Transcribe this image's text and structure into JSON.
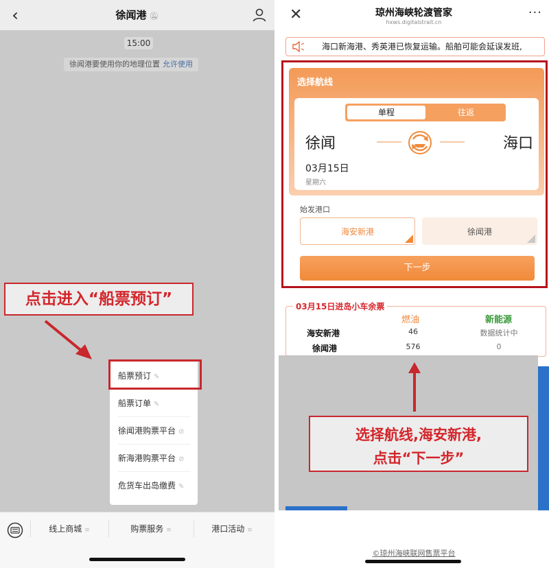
{
  "left": {
    "title": "徐闻港",
    "time": "15:00",
    "location_notice": "徐闻港要使用你的地理位置",
    "location_allow": "允许使用",
    "annotation": "点击进入“船票预订”",
    "menu": [
      "船票预订",
      "船票订单",
      "徐闻港购票平台",
      "新海港购票平台",
      "危货车出岛缴费"
    ],
    "tabs": [
      "线上商城",
      "购票服务",
      "港口活动"
    ],
    "colors": {
      "annotation_red": "#c8272c"
    }
  },
  "right": {
    "title": "琼州海峡轮渡管家",
    "url": "hxws.digitalstrait.cn",
    "notice": "海口新海港、秀英港已恢复运输。船舶可能会延误发班,",
    "section_label": "选择航线",
    "trip_one_way": "单程",
    "trip_round": "往返",
    "from_city": "徐闻",
    "to_city": "海口",
    "date": "03月15日",
    "weekday": "星期六",
    "port_label": "始发港口",
    "ports": [
      "海安新港",
      "徐闻港"
    ],
    "next_button": "下一步",
    "stats": {
      "title": "03月15日进岛小车余票",
      "headers": [
        "燃油",
        "新能源"
      ],
      "rows": [
        {
          "name": "海安新港",
          "fuel": "46",
          "ev": "数据统计中"
        },
        {
          "name": "徐闻港",
          "fuel": "576",
          "ev": "0"
        }
      ]
    },
    "annotation_line1": "选择航线,海安新港,",
    "annotation_line2": "点击“下一步”",
    "footer": "©琼州海峡联网售票平台",
    "colors": {
      "accent_orange": "#f08a3a",
      "ev_green": "#3a9a3a",
      "highlight_red": "#b5121b"
    }
  }
}
